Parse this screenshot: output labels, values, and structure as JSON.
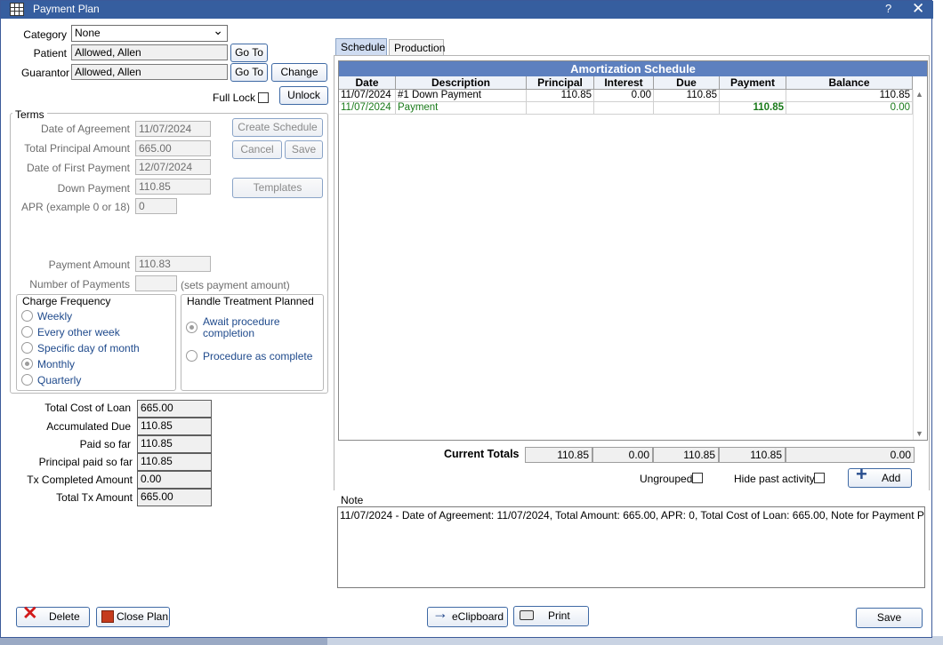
{
  "window": {
    "title": "Payment Plan",
    "help": "?",
    "close": "✕"
  },
  "patient_info": {
    "category_label": "Category",
    "category_value": "None",
    "category_arrow": "⌄",
    "patient_label": "Patient",
    "patient_value": "Allowed, Allen",
    "guarantor_label": "Guarantor",
    "guarantor_value": "Allowed, Allen",
    "goto_label": "Go To",
    "change_label": "Change",
    "full_lock_label": "Full Lock",
    "unlock_label": "Unlock"
  },
  "terms": {
    "group_label": "Terms",
    "date_of_agreement_label": "Date of Agreement",
    "date_of_agreement_value": "11/07/2024",
    "total_principal_label": "Total Principal Amount",
    "total_principal_value": "665.00",
    "first_payment_label": "Date of First Payment",
    "first_payment_value": "12/07/2024",
    "down_payment_label": "Down Payment",
    "down_payment_value": "110.85",
    "apr_label": "APR (example 0 or 18)",
    "apr_value": "0",
    "payment_amount_label": "Payment Amount",
    "payment_amount_value": "110.83",
    "num_payments_label": "Number of Payments",
    "num_payments_value": "",
    "num_payments_hint": "(sets payment amount)",
    "create_schedule_label": "Create Schedule",
    "cancel_label": "Cancel",
    "save_label": "Save",
    "templates_label": "Templates"
  },
  "charge_frequency": {
    "title": "Charge Frequency",
    "options": [
      "Weekly",
      "Every other week",
      "Specific day of month",
      "Monthly",
      "Quarterly"
    ],
    "selected": "Monthly"
  },
  "treatment_planned": {
    "title": "Handle Treatment Planned",
    "option1_line1": "Await procedure",
    "option1_line2": "completion",
    "option2": "Procedure as complete",
    "selected": "Await procedure completion"
  },
  "summary": {
    "total_cost_label": "Total Cost of Loan",
    "total_cost_value": "665.00",
    "accumulated_due_label": "Accumulated Due",
    "accumulated_due_value": "110.85",
    "paid_so_far_label": "Paid so far",
    "paid_so_far_value": "110.85",
    "principal_paid_label": "Principal paid so far",
    "principal_paid_value": "110.85",
    "tx_completed_label": "Tx Completed Amount",
    "tx_completed_value": "0.00",
    "total_tx_label": "Total Tx Amount",
    "total_tx_value": "665.00"
  },
  "tabs": {
    "schedule": "Schedule",
    "production": "Production"
  },
  "schedule": {
    "title": "Amortization Schedule",
    "columns": [
      "Date",
      "Description",
      "Principal",
      "Interest",
      "Due",
      "Payment",
      "Balance"
    ],
    "rows": [
      [
        "11/07/2024",
        "#1 Down Payment",
        "110.85",
        "0.00",
        "110.85",
        "",
        "110.85"
      ],
      [
        "11/07/2024",
        "Payment",
        "",
        "",
        "",
        "110.85",
        "0.00"
      ]
    ],
    "payment_row_color": "#1a7a1a",
    "totals_label": "Current Totals",
    "totals": [
      "110.85",
      "0.00",
      "110.85",
      "110.85",
      "0.00"
    ],
    "ungrouped_label": "Ungrouped",
    "hide_past_label": "Hide past activity",
    "add_label": "Add"
  },
  "note": {
    "label": "Note",
    "text": "11/07/2024 - Date of Agreement: 11/07/2024, Total Amount: 665.00, APR: 0, Total Cost of Loan: 665.00, Note for Payment Plan"
  },
  "footer": {
    "delete_label": "Delete",
    "close_plan_label": "Close Plan",
    "eclipboard_label": "eClipboard",
    "print_label": "Print",
    "save_label": "Save"
  },
  "colors": {
    "titlebar": "#365e9f",
    "grid_title": "#5d80bf",
    "accent": "#3f6aa5"
  }
}
